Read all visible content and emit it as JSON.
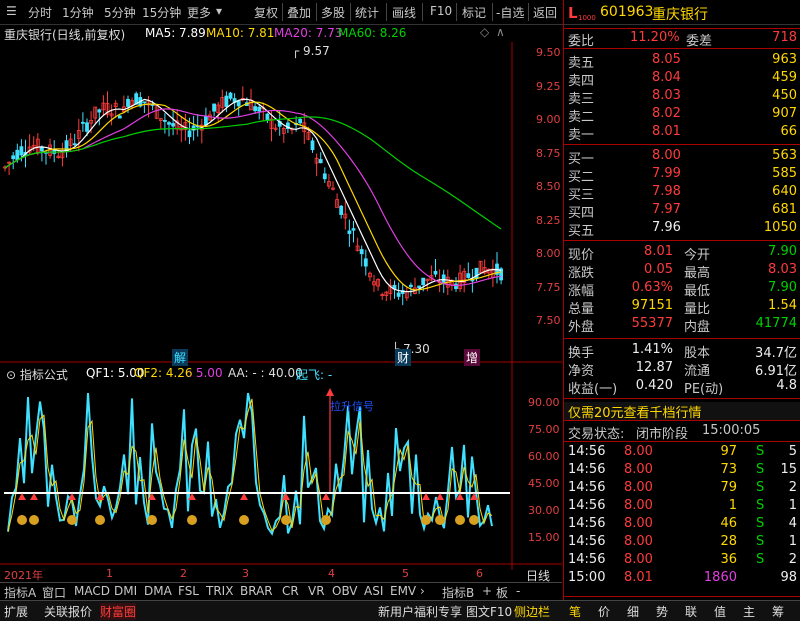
{
  "toolbar": {
    "items": [
      "分时",
      "1分钟",
      "5分钟",
      "15分钟",
      "更多",
      "复权",
      "叠加",
      "多股",
      "统计",
      "画线",
      "F10",
      "标记",
      "-自选",
      "返回"
    ]
  },
  "stock": {
    "logo": "L",
    "code": "601963",
    "name": "重庆银行",
    "code_prefix": "1000"
  },
  "kline": {
    "title": "重庆银行(日线,前复权)",
    "ma5": "MA5: 7.89",
    "ma10": "MA10: 7.81",
    "ma20": "MA20: 7.73",
    "ma60": "MA60: 8.26",
    "high_label": "9.57",
    "low_label": "7.30",
    "marks": [
      "解",
      "财",
      "增"
    ],
    "price_ticks": [
      "9.50",
      "9.25",
      "9.00",
      "8.75",
      "8.50",
      "8.25",
      "8.00",
      "7.75",
      "7.50"
    ],
    "colors": {
      "ma5": "#ffffff",
      "ma10": "#ffd800",
      "ma20": "#e040e0",
      "ma60": "#00d000",
      "up": "#ff3b3b",
      "down": "#40e0ff"
    }
  },
  "indicator": {
    "title": "指标公式",
    "qf1": "QF1: 5.00",
    "qf2": "QF2: 4.26",
    "v3": ": 5.00",
    "aa": "AA: - : 40.00",
    "qifei": "起飞: -",
    "annotation": "拉升信号",
    "ticks": [
      "90.00",
      "75.00",
      "60.00",
      "45.00",
      "30.00",
      "15.00"
    ]
  },
  "xaxis": {
    "labels": [
      "2021年",
      "1",
      "2",
      "3",
      "4",
      "5",
      "6"
    ],
    "period": "日线"
  },
  "tabs": [
    "指标A",
    "窗口",
    "MACD",
    "DMI",
    "DMA",
    "FSL",
    "TRIX",
    "BRAR",
    "CR",
    "VR",
    "OBV",
    "ASI",
    "EMV",
    "指标B",
    "板"
  ],
  "quote": {
    "weibi_label": "委比",
    "weibi": "11.20%",
    "weicha_label": "委差",
    "weicha": "718",
    "asks": [
      {
        "label": "卖五",
        "price": "8.05",
        "vol": "963"
      },
      {
        "label": "卖四",
        "price": "8.04",
        "vol": "459"
      },
      {
        "label": "卖三",
        "price": "8.03",
        "vol": "450"
      },
      {
        "label": "卖二",
        "price": "8.02",
        "vol": "907"
      },
      {
        "label": "卖一",
        "price": "8.01",
        "vol": "66"
      }
    ],
    "bids": [
      {
        "label": "买一",
        "price": "8.00",
        "vol": "563"
      },
      {
        "label": "买二",
        "price": "7.99",
        "vol": "585"
      },
      {
        "label": "买三",
        "price": "7.98",
        "vol": "640"
      },
      {
        "label": "买四",
        "price": "7.97",
        "vol": "681"
      },
      {
        "label": "买五",
        "price": "7.96",
        "vol": "1050"
      }
    ],
    "stats": [
      [
        "现价",
        "8.01",
        "今开",
        "7.90"
      ],
      [
        "涨跌",
        "0.05",
        "最高",
        "8.03"
      ],
      [
        "涨幅",
        "0.63%",
        "最低",
        "7.90"
      ],
      [
        "总量",
        "97151",
        "量比",
        "1.54"
      ],
      [
        "外盘",
        "55377",
        "内盘",
        "41774"
      ]
    ],
    "stats2": [
      [
        "换手",
        "1.41%",
        "股本",
        "34.7亿"
      ],
      [
        "净资",
        "12.87",
        "流通",
        "6.91亿"
      ],
      [
        "收益(一)",
        "0.420",
        "PE(动)",
        "4.8"
      ]
    ],
    "promo": "仅需20元查看千档行情",
    "trade_state_label": "交易状态:",
    "trade_state": "闭市阶段",
    "trade_time": "15:00:05",
    "ticks": [
      [
        "14:56",
        "8.00",
        "97",
        "S",
        "5"
      ],
      [
        "14:56",
        "8.00",
        "73",
        "S",
        "15"
      ],
      [
        "14:56",
        "8.00",
        "79",
        "S",
        "2"
      ],
      [
        "14:56",
        "8.00",
        "1",
        "S",
        "1"
      ],
      [
        "14:56",
        "8.00",
        "46",
        "S",
        "4"
      ],
      [
        "14:56",
        "8.00",
        "28",
        "S",
        "1"
      ],
      [
        "14:56",
        "8.00",
        "36",
        "S",
        "2"
      ],
      [
        "15:00",
        "8.01",
        "1860",
        "",
        "98"
      ]
    ],
    "panel_tabs": [
      "笔",
      "价",
      "细",
      "势",
      "联",
      "值",
      "主",
      "筹"
    ]
  },
  "statusbar": {
    "items": [
      "扩展",
      "关联报价",
      "财富圈"
    ],
    "right": [
      "新用户福利专享",
      "图文F10",
      "侧边栏"
    ]
  }
}
